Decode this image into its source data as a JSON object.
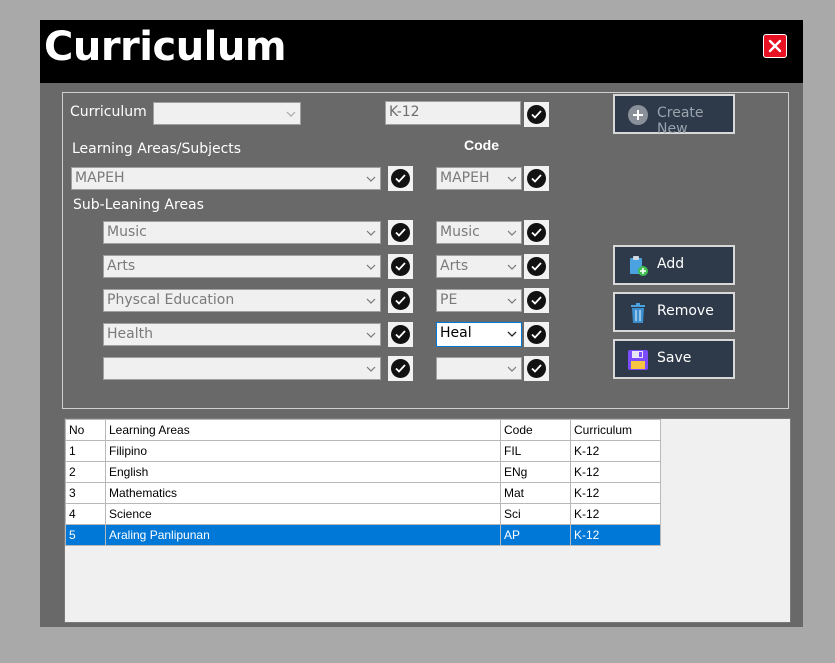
{
  "window": {
    "title": "Curriculum"
  },
  "form": {
    "curriculum_label": "Curriculum",
    "curriculum_combo_value": "",
    "curriculum_text": "K-12",
    "create_new_label": "Create New",
    "learning_areas_label": "Learning Areas/Subjects",
    "code_header": "Code",
    "learning_area_value": "MAPEH",
    "learning_area_code": "MAPEH",
    "sub_areas_label": "Sub-Leaning Areas",
    "sub_areas": [
      {
        "name": "Music",
        "code": "Music"
      },
      {
        "name": "Arts",
        "code": "Arts"
      },
      {
        "name": "Physcal Education",
        "code": "PE"
      },
      {
        "name": "Health",
        "code": "Heal"
      },
      {
        "name": "",
        "code": ""
      }
    ],
    "add_label": "Add",
    "remove_label": "Remove",
    "save_label": "Save"
  },
  "grid": {
    "columns": [
      "No",
      "Learning Areas",
      "Code",
      "Curriculum"
    ],
    "rows": [
      [
        "1",
        "Filipino",
        "FIL",
        "K-12"
      ],
      [
        "2",
        "English",
        "ENg",
        "K-12"
      ],
      [
        "3",
        "Mathematics",
        "Mat",
        "K-12"
      ],
      [
        "4",
        "Science",
        "Sci",
        "K-12"
      ],
      [
        "5",
        "Araling Panlipunan",
        "AP",
        "K-12"
      ]
    ],
    "selected_row": 5
  },
  "colors": {
    "title_bar": "#000000",
    "panel_bg": "#696969",
    "button_bg": "#2e3a4a",
    "selection": "#0078d7"
  },
  "icons": [
    "close-icon",
    "plus-circle-icon",
    "clipboard-add-icon",
    "trash-icon",
    "save-icon",
    "check-icon",
    "chevron-down-icon"
  ]
}
